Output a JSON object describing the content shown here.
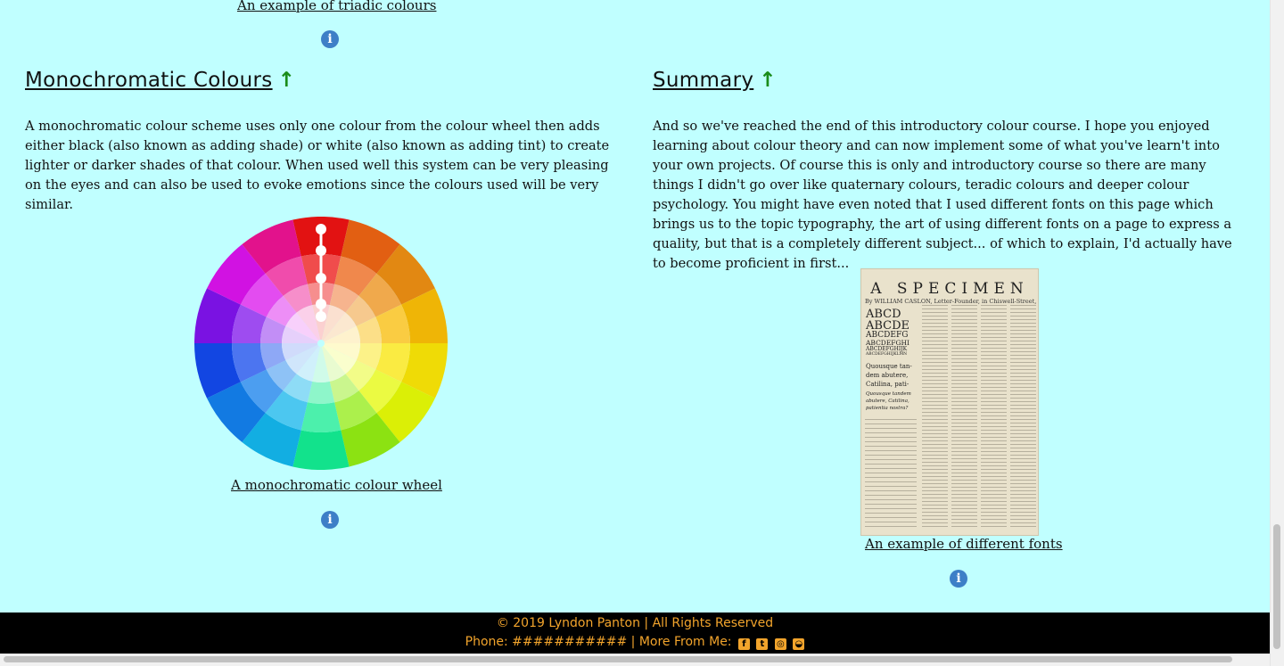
{
  "top_caption": "An example of triadic colours",
  "left": {
    "title": "Monochromatic Colours",
    "arrow": "↑",
    "body": "A monochromatic colour scheme uses only one colour from the colour wheel then adds either black (also known as adding shade) or white (also known as adding tint) to create lighter or darker shades of that colour. When used well this system can be very pleasing on the eyes and can also be used to evoke emotions since the colours used will be very similar.",
    "caption": "A monochromatic colour wheel"
  },
  "right": {
    "title": "Summary",
    "arrow": "↑",
    "body": "And so we've reached the end of this introductory colour course. I hope you enjoyed learning about colour theory and can now implement some of what you've learn't into your own projects. Of course this is only and introductory course so there are many things I didn't go over like quaternary colours, teradic colours and deeper colour psychology. You might have even noted that I used different fonts on this page which brings us to the topic typography, the art of using different fonts on a page to express a quality, but that is a completely different subject... of which to explain, I'd actually have to become proficient in first...",
    "caption": "An example of different fonts",
    "specimen": {
      "title": "A SPECIMEN",
      "subtitle": "By WILLIAM CASLON, Letter-Founder, in Chiswell-Street, LONDON.",
      "big_lines": [
        "ABCD",
        "ABCDE",
        "ABCDEFG",
        "ABCDEFGHI",
        "ABCDEFGHIJK",
        "ABCDEFGHIJKLMN"
      ],
      "latin_lines": [
        "Quousque tan-",
        "dem abutere,",
        "Catilina, pati-",
        "Quousque tandem",
        "abutere, Catilina,",
        "patientia nostra?"
      ]
    }
  },
  "info_icon": "i",
  "footer": {
    "line1": "© 2019 Lyndon Panton | All Rights Reserved",
    "line2": "Phone: ########### | More From Me:",
    "social": [
      {
        "name": "facebook-icon",
        "glyph": "f"
      },
      {
        "name": "twitter-icon",
        "glyph": "t"
      },
      {
        "name": "instagram-icon",
        "glyph": "◎"
      },
      {
        "name": "github-icon",
        "glyph": "◒"
      }
    ]
  },
  "colors": {
    "background": "#c0ffff",
    "footer_bg": "#000000",
    "footer_text": "#f2a42c",
    "arrow": "#1a8c1a",
    "info": "#3d7fc7"
  }
}
